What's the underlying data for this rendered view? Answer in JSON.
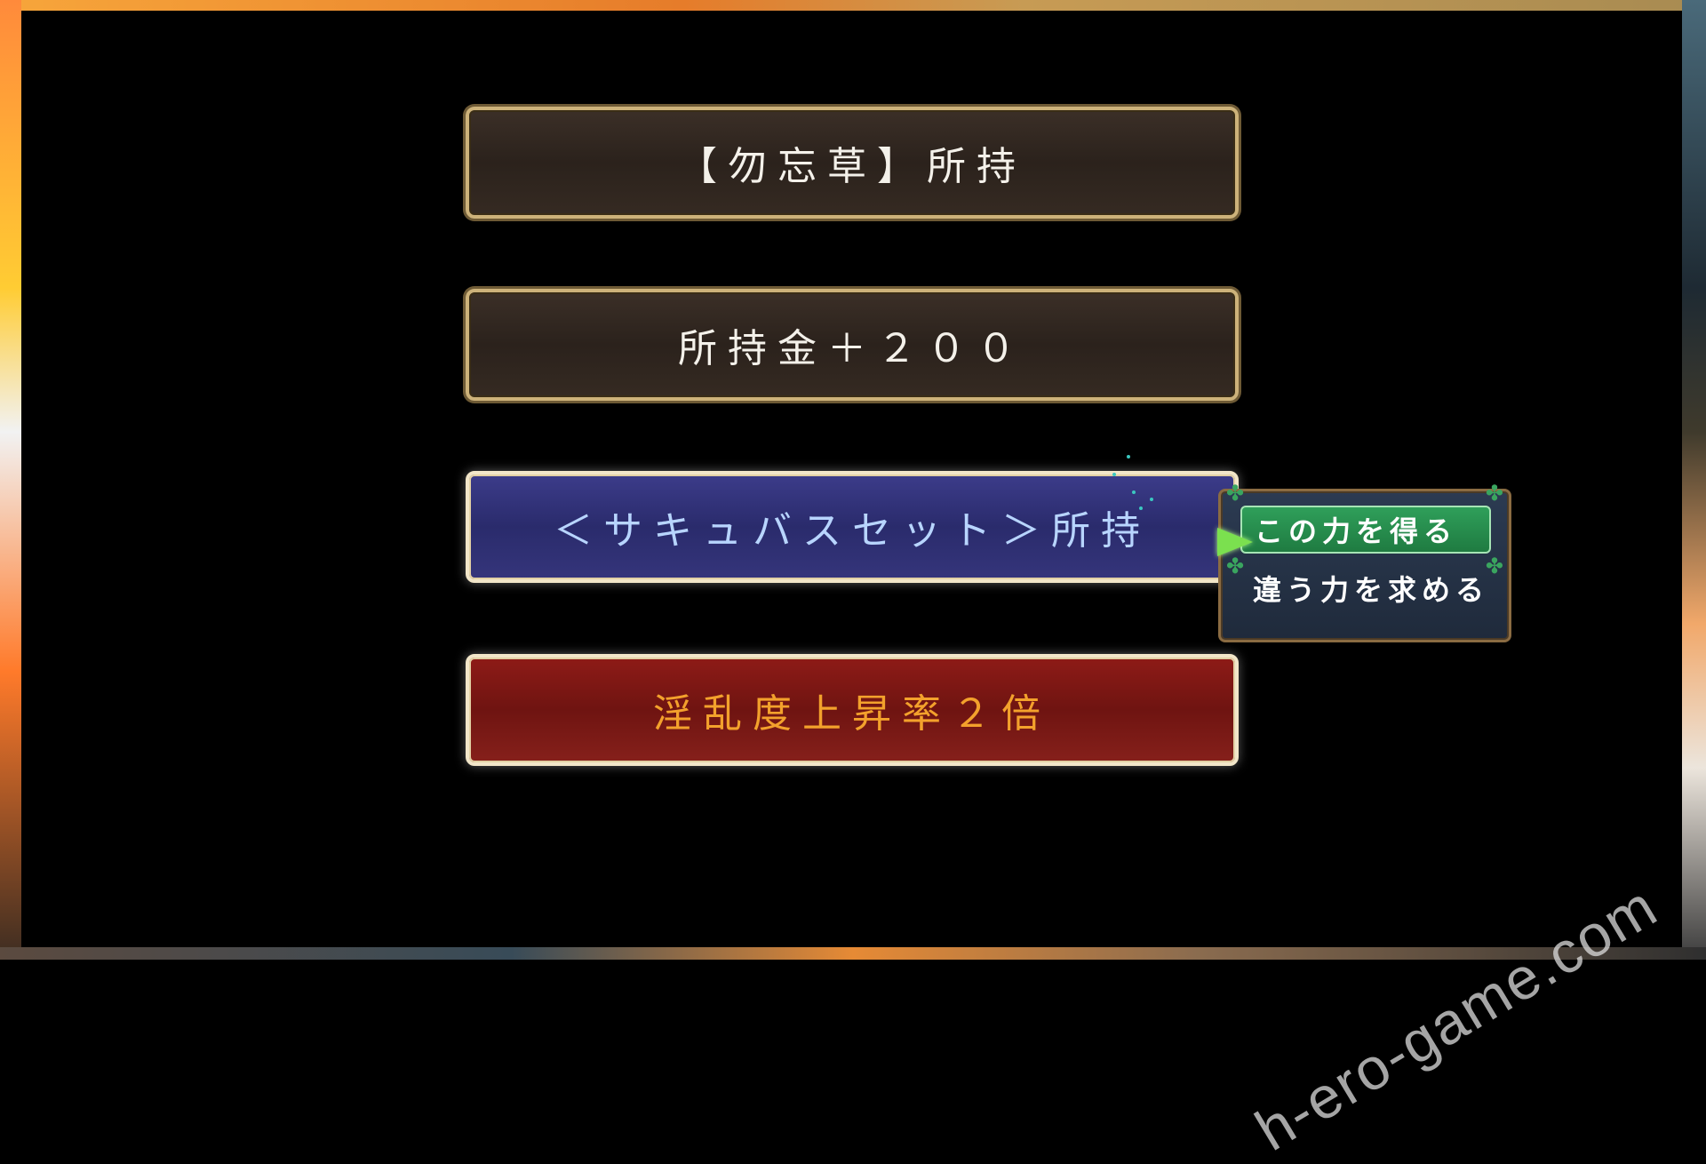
{
  "choices": [
    {
      "label": "【勿忘草】所持",
      "style": "brown"
    },
    {
      "label": "所持金＋２００",
      "style": "brown"
    },
    {
      "label": "＜サキュバスセット＞所持",
      "style": "blue",
      "selected": true
    },
    {
      "label": "淫乱度上昇率２倍",
      "style": "red"
    }
  ],
  "confirm_menu": {
    "items": [
      {
        "label": "この力を得る",
        "selected": true
      },
      {
        "label": "違う力を求める",
        "selected": false
      }
    ]
  },
  "colors": {
    "brown_panel": "#2b221c",
    "blue_panel": "#2a2b6c",
    "red_panel": "#6f1411",
    "gold_border": "#cdb27a",
    "menu_selected": "#1f7b41"
  },
  "icons": {
    "cursor": "green-arrow-cursor-icon",
    "decor": "clover-icon"
  },
  "watermark": "h-ero-game.com"
}
